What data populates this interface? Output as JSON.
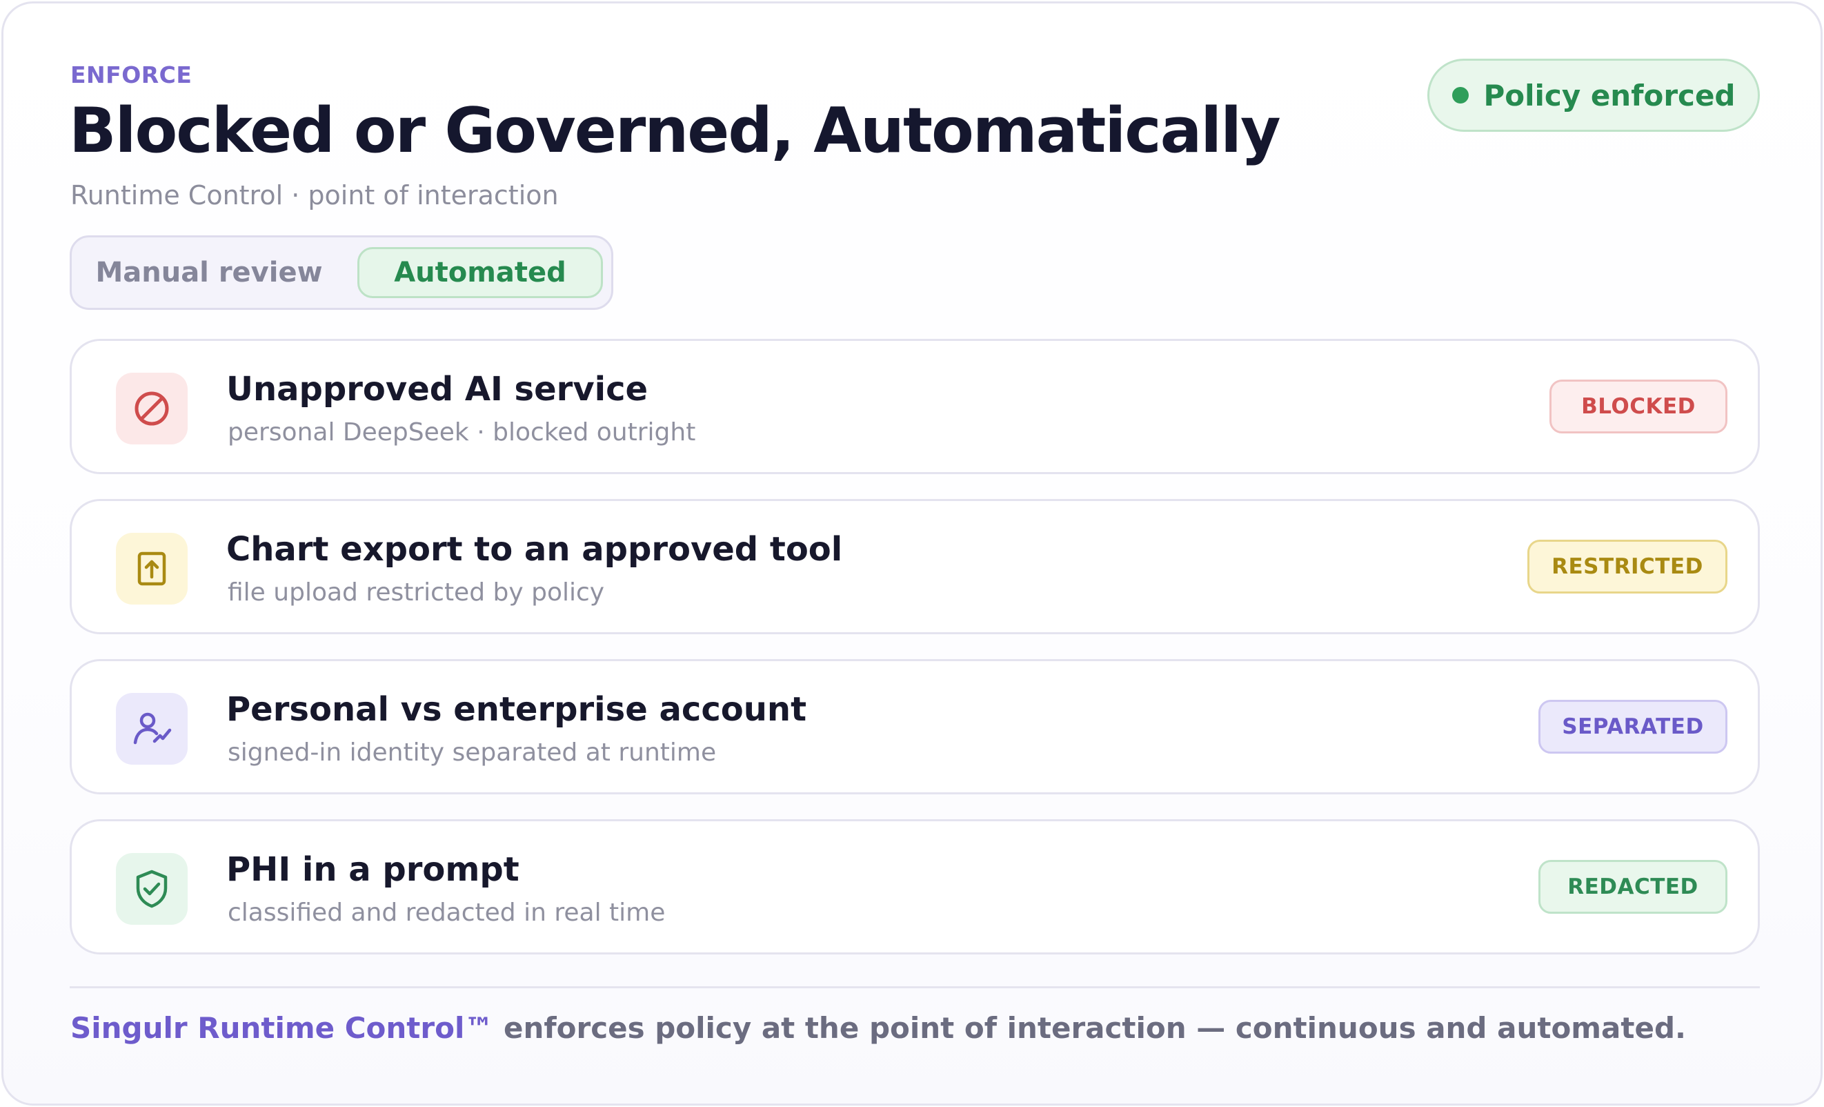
{
  "header": {
    "eyebrow": "ENFORCE",
    "title": "Blocked or Governed, Automatically",
    "subtitle": "Runtime Control · point of interaction"
  },
  "status_badge": {
    "label": "Policy enforced",
    "color": "#2f9e5a"
  },
  "mode_toggle": {
    "options": [
      "Manual review",
      "Automated"
    ],
    "selected": "Automated"
  },
  "events": [
    {
      "title": "Unapproved AI service",
      "subtitle": "personal DeepSeek · blocked outright",
      "status": "BLOCKED",
      "icon": "block-icon",
      "color": "#cf4c4c",
      "icon_bg": "#fce8e8",
      "pill_bg": "#fdeeee",
      "pill_border": "#f1c3c3"
    },
    {
      "title": "Chart export to an approved tool",
      "subtitle": "file upload restricted by policy",
      "status": "RESTRICTED",
      "icon": "upload-icon",
      "color": "#a98a12",
      "icon_bg": "#fdf6d8",
      "pill_bg": "#fdf6d8",
      "pill_border": "#e8d68a"
    },
    {
      "title": "Personal vs enterprise account",
      "subtitle": "signed-in identity separated at runtime",
      "status": "SEPARATED",
      "icon": "user-icon",
      "color": "#6a5ac8",
      "icon_bg": "#ebe9fb",
      "pill_bg": "#ebe9fb",
      "pill_border": "#cdc7f1"
    },
    {
      "title": "PHI in a prompt",
      "subtitle": "classified and redacted in real time",
      "status": "REDACTED",
      "icon": "shield-check-icon",
      "color": "#2e8b55",
      "icon_bg": "#e7f6ec",
      "pill_bg": "#e9f7ec",
      "pill_border": "#bfe3c9"
    }
  ],
  "footer": {
    "brand": "Singulr Runtime Control™",
    "text": " enforces policy at the point of interaction — continuous and automated."
  }
}
